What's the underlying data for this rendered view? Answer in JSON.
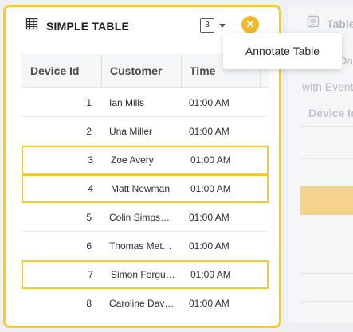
{
  "widget": {
    "title": "SIMPLE TABLE",
    "icon": "table-icon",
    "selected_count": "3",
    "close_icon": "close-icon",
    "accent_color": "#f3c937"
  },
  "menu": {
    "items": [
      {
        "label": "Annotate Table"
      }
    ]
  },
  "table": {
    "columns": [
      "Device Id",
      "Customer",
      "Time"
    ],
    "rows": [
      {
        "id": "1",
        "customer": "Ian Mills",
        "time": "01:00 AM",
        "highlighted": false
      },
      {
        "id": "2",
        "customer": "Una Miller",
        "time": "01:00 AM",
        "highlighted": false
      },
      {
        "id": "3",
        "customer": "Zoe Avery",
        "time": "01:00 AM",
        "highlighted": true
      },
      {
        "id": "4",
        "customer": "Matt Newman",
        "time": "01:00 AM",
        "highlighted": true
      },
      {
        "id": "5",
        "customer": "Colin Simps…",
        "time": "01:00 AM",
        "highlighted": false
      },
      {
        "id": "6",
        "customer": "Thomas Met…",
        "time": "01:00 AM",
        "highlighted": false
      },
      {
        "id": "7",
        "customer": "Simon Fergu…",
        "time": "01:00 AM",
        "highlighted": true
      },
      {
        "id": "8",
        "customer": "Caroline Dav…",
        "time": "01:00 AM",
        "highlighted": false
      }
    ]
  },
  "background_widget": {
    "title": "Table",
    "icon": "table-icon",
    "text_line1": "Da",
    "text_line2": "with Event",
    "column_header": "Device Id"
  }
}
